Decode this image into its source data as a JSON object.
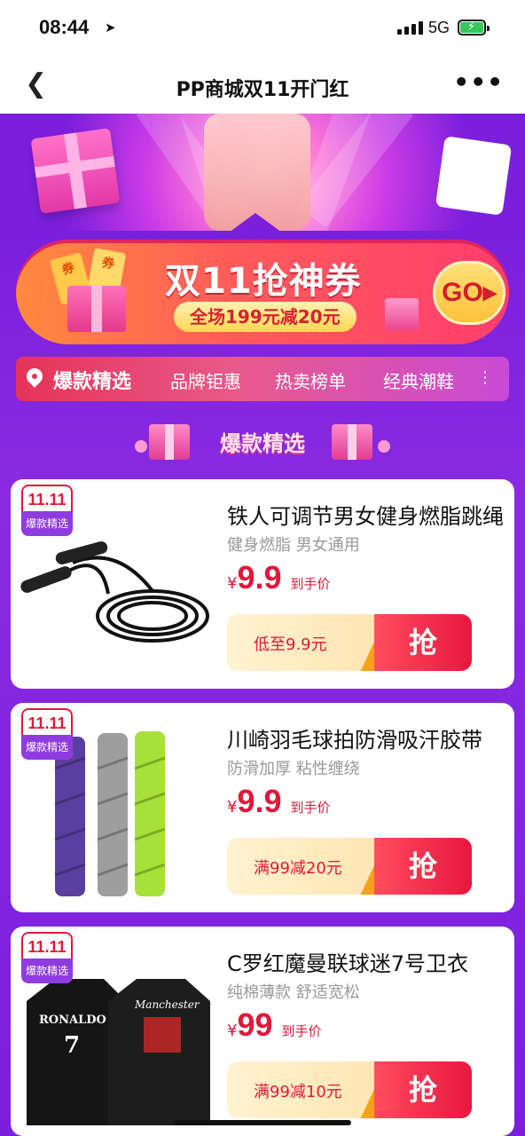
{
  "status": {
    "time": "08:44",
    "network": "5G"
  },
  "nav": {
    "title": "PP商城双11开门红"
  },
  "coupon": {
    "tag1": "券",
    "tag2": "券",
    "headline": "双11抢神券",
    "subline": "全场199元减20元",
    "go_label": "GO▸"
  },
  "tabs": [
    "爆款精选",
    "品牌钜惠",
    "热卖榜单",
    "经典潮鞋"
  ],
  "section": {
    "title": "爆款精选"
  },
  "products": [
    {
      "badge_top": "11.11",
      "badge_bottom": "爆款精选",
      "name": "铁人可调节男女健身燃脂跳绳",
      "desc": "健身燃脂 男女通用",
      "currency": "¥",
      "price": "9.9",
      "price_tail": "到手价",
      "deal": "低至9.9元",
      "grab": "抢"
    },
    {
      "badge_top": "11.11",
      "badge_bottom": "爆款精选",
      "name": "川崎羽毛球拍防滑吸汗胶带",
      "desc": "防滑加厚 粘性缠绕",
      "currency": "¥",
      "price": "9.9",
      "price_tail": "到手价",
      "deal": "满99减20元",
      "grab": "抢"
    },
    {
      "badge_top": "11.11",
      "badge_bottom": "爆款精选",
      "name": "C罗红魔曼联球迷7号卫衣",
      "desc": "纯棉薄款 舒适宽松",
      "currency": "¥",
      "price": "99",
      "price_tail": "到手价",
      "deal": "满99减10元",
      "grab": "抢",
      "img_text_left": "RONALDO",
      "img_num": "7",
      "img_text_right": "Manchester"
    }
  ]
}
